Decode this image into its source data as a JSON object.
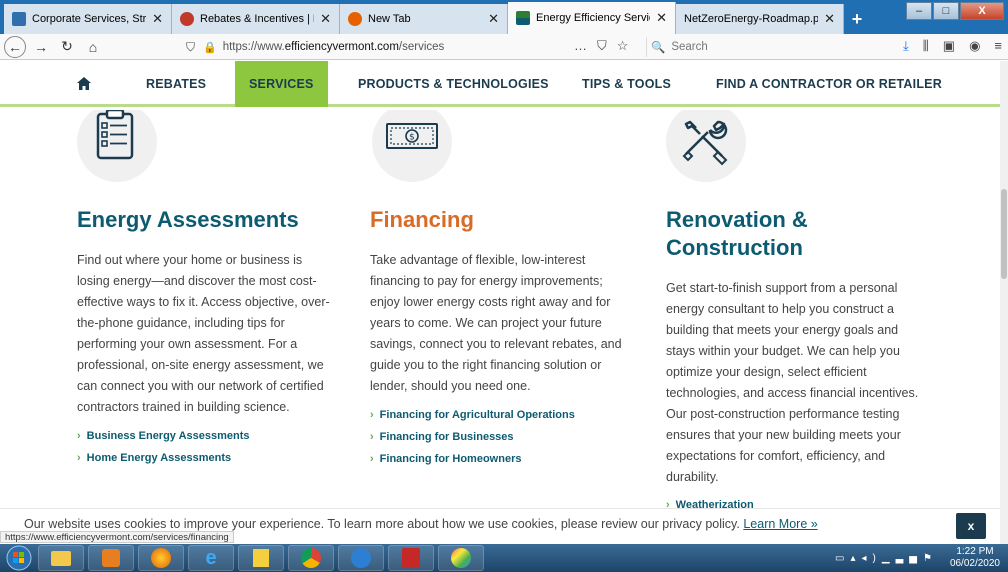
{
  "browser": {
    "tabs": [
      {
        "title": "Corporate Services, Strategy, R",
        "icon_color": "#2f6fad",
        "active": false
      },
      {
        "title": "Rebates & Incentives | Burlingt",
        "icon_color": "#c0392b",
        "active": false
      },
      {
        "title": "New Tab",
        "icon_color": "#e66000",
        "active": false
      },
      {
        "title": "Energy Efficiency Services & Pr",
        "icon_color": "#2e7d32",
        "active": true
      },
      {
        "title": "NetZeroEnergy-Roadmap.pdf",
        "icon_color": "#777777",
        "active": false
      }
    ],
    "url_prefix": "https://www.",
    "url_domain": "efficiencyvermont.com",
    "url_path": "/services",
    "search_placeholder": "Search",
    "page_actions": "…",
    "status_url": "https://www.efficiencyvermont.com/services/financing"
  },
  "site": {
    "nav": {
      "rebates": "REBATES",
      "services": "SERVICES",
      "products": "PRODUCTS & TECHNOLOGIES",
      "tips": "TIPS & TOOLS",
      "contractor": "FIND A CONTRACTOR OR RETAILER"
    },
    "columns": [
      {
        "title": "Energy Assessments",
        "color": "#0d5b71",
        "desc_lines": [
          "Find out where your home or business is",
          "losing energy—and discover the most cost-",
          "effective ways to fix it. Access objective, over-",
          "the-phone guidance, including tips for",
          "performing your own assessment. For a",
          "professional, on-site energy assessment, we",
          "can connect you with our network of certified",
          "contractors trained in building science."
        ],
        "links": [
          "Business Energy Assessments",
          "Home Energy Assessments"
        ]
      },
      {
        "title": "Financing",
        "color": "#d86c27",
        "desc_lines": [
          "Take advantage of flexible, low-interest",
          "financing to pay for energy improvements;",
          "enjoy lower energy costs right away and for",
          "years to come. We can project your future",
          "savings, connect you to relevant rebates, and",
          "guide you to the right financing solution or",
          "lender, should you need one."
        ],
        "links": [
          "Financing for Agricultural Operations",
          "Financing for Businesses",
          "Financing for Homeowners"
        ]
      },
      {
        "title_lines": [
          "Renovation &",
          "Construction"
        ],
        "color": "#0d5b71",
        "desc_lines": [
          "Get start-to-finish support from a personal",
          "energy consultant to help you construct a",
          "building that meets your energy goals and",
          "stays within your budget. We can help you",
          "optimize your design, select efficient",
          "technologies, and access financial incentives.",
          "Our post-construction performance testing",
          "ensures that your new building meets your",
          "expectations for comfort, efficiency, and",
          "durability."
        ],
        "links": [
          "Weatherization"
        ]
      }
    ],
    "cookie": {
      "text": "Our website uses cookies to improve your experience. To learn more about how we use cookies, please review our privacy policy.",
      "link": "Learn More »",
      "close": "x"
    }
  },
  "taskbar": {
    "time": "1:22 PM",
    "date": "06/02/2020"
  }
}
